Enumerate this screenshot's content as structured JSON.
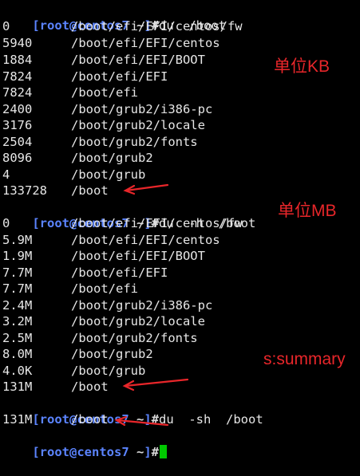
{
  "prompt": {
    "open_bracket": "[",
    "user_host": "root@centos7",
    "cwd": " ~",
    "close_bracket": "]",
    "hash": "#"
  },
  "commands": [
    "du  /boot",
    "du  -h  /boot",
    "du  -sh  /boot"
  ],
  "block1": [
    {
      "size": "0",
      "path": "/boot/efi/EFI/centos/fw"
    },
    {
      "size": "5940",
      "path": "/boot/efi/EFI/centos"
    },
    {
      "size": "1884",
      "path": "/boot/efi/EFI/BOOT"
    },
    {
      "size": "7824",
      "path": "/boot/efi/EFI"
    },
    {
      "size": "7824",
      "path": "/boot/efi"
    },
    {
      "size": "2400",
      "path": "/boot/grub2/i386-pc"
    },
    {
      "size": "3176",
      "path": "/boot/grub2/locale"
    },
    {
      "size": "2504",
      "path": "/boot/grub2/fonts"
    },
    {
      "size": "8096",
      "path": "/boot/grub2"
    },
    {
      "size": "4",
      "path": "/boot/grub"
    },
    {
      "size": "133728",
      "path": "/boot"
    }
  ],
  "block2": [
    {
      "size": "0",
      "path": "/boot/efi/EFI/centos/fw"
    },
    {
      "size": "5.9M",
      "path": "/boot/efi/EFI/centos"
    },
    {
      "size": "1.9M",
      "path": "/boot/efi/EFI/BOOT"
    },
    {
      "size": "7.7M",
      "path": "/boot/efi/EFI"
    },
    {
      "size": "7.7M",
      "path": "/boot/efi"
    },
    {
      "size": "2.4M",
      "path": "/boot/grub2/i386-pc"
    },
    {
      "size": "3.2M",
      "path": "/boot/grub2/locale"
    },
    {
      "size": "2.5M",
      "path": "/boot/grub2/fonts"
    },
    {
      "size": "8.0M",
      "path": "/boot/grub2"
    },
    {
      "size": "4.0K",
      "path": "/boot/grub"
    },
    {
      "size": "131M",
      "path": "/boot"
    }
  ],
  "block3": [
    {
      "size": "131M",
      "path": "/boot"
    }
  ],
  "annotations": {
    "unit_kb": "单位KB",
    "unit_mb": "单位MB",
    "summary": "s:summary"
  },
  "colors": {
    "background": "#000000",
    "prompt": "#5b84ff",
    "text": "#e6e6e6",
    "annotation": "#e8262a",
    "cursor": "#00c800"
  }
}
